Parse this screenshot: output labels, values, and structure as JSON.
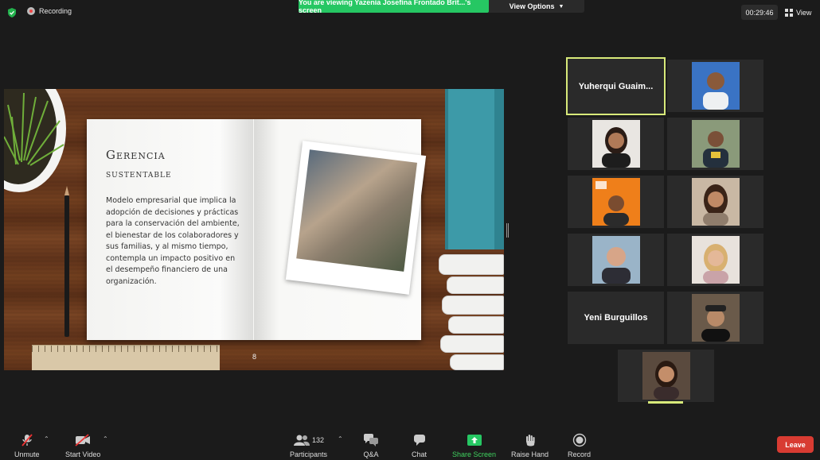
{
  "topbar": {
    "recording_label": "Recording",
    "viewing_banner": "You are viewing Yazenia Josefina Frontado Brit...'s screen",
    "view_options_label": "View Options",
    "timer": "00:29:46",
    "view_label": "View"
  },
  "slide": {
    "title": "Gerencia",
    "subtitle": "sustentable",
    "body": "Modelo empresarial que implica la adopción de decisiones y prácticas para la conservación del ambiente, el bienestar de los colaboradores y sus familias, y al mismo tiempo, contempla un impacto positivo en el desempeño financiero de una organización.",
    "page_number": "8"
  },
  "participants": {
    "tiles": [
      {
        "name": "Yuherqui  Guaim...",
        "kind": "name",
        "active": true
      },
      {
        "kind": "video"
      },
      {
        "kind": "video"
      },
      {
        "kind": "video"
      },
      {
        "kind": "video"
      },
      {
        "kind": "video"
      },
      {
        "kind": "video"
      },
      {
        "kind": "video"
      },
      {
        "name": "Yeni Burguillos",
        "kind": "name"
      },
      {
        "kind": "video"
      },
      {
        "kind": "video"
      }
    ]
  },
  "toolbar": {
    "unmute": "Unmute",
    "start_video": "Start Video",
    "participants": "Participants",
    "participants_count": "132",
    "qa": "Q&A",
    "chat": "Chat",
    "share_screen": "Share Screen",
    "raise_hand": "Raise Hand",
    "record": "Record",
    "leave": "Leave"
  },
  "colors": {
    "share_green": "#26c763",
    "leave_red": "#d83b32",
    "active_speaker": "#d8ea7a"
  }
}
